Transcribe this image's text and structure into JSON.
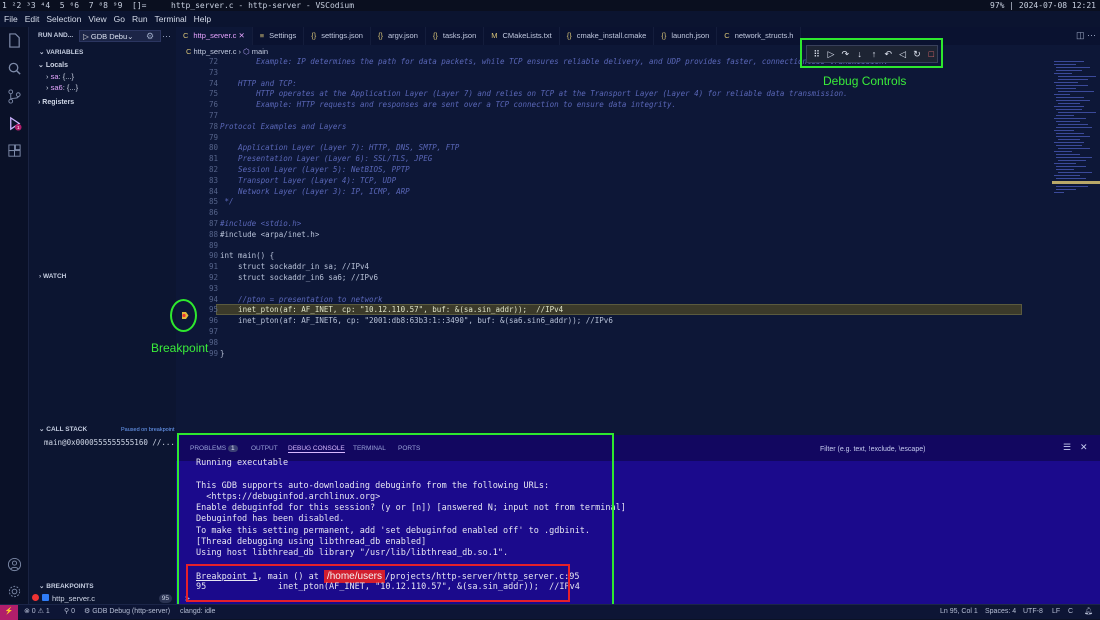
{
  "top_bar": {
    "workspaces": "1 ²2 ³3 ⁴4  5 ⁶6  7 ⁸8 ⁹9  []=",
    "window_title": "http_server.c - http-server - VSCodium",
    "status": "97% | 2024-07-08 12:21"
  },
  "menu": [
    "File",
    "Edit",
    "Selection",
    "View",
    "Go",
    "Run",
    "Terminal",
    "Help"
  ],
  "sidebar": {
    "run_label": "RUN AND...",
    "config": "GDB Debu",
    "variables_header": "VARIABLES",
    "locals": "Locals",
    "vars": [
      {
        "name": "sa",
        "value": "{...}"
      },
      {
        "name": "sa6",
        "value": "{...}"
      }
    ],
    "registers": "Registers",
    "watch_header": "WATCH",
    "call_stack_header": "CALL STACK",
    "call_stack_status": "Paused on breakpoint",
    "call_stack_frame": "main@0x0000555555555160  //...",
    "breakpoints_header": "BREAKPOINTS",
    "breakpoint_file": "http_server.c",
    "breakpoint_line": "95"
  },
  "tabs": [
    {
      "icon": "C",
      "label": "http_server.c",
      "active": true
    },
    {
      "icon": "≡",
      "label": "Settings"
    },
    {
      "icon": "{}",
      "label": "settings.json"
    },
    {
      "icon": "{}",
      "label": "argv.json"
    },
    {
      "icon": "{}",
      "label": "tasks.json"
    },
    {
      "icon": "M",
      "label": "CMakeLists.txt"
    },
    {
      "icon": "{}",
      "label": "cmake_install.cmake"
    },
    {
      "icon": "{}",
      "label": "launch.json"
    },
    {
      "icon": "C",
      "label": "network_structs.h"
    }
  ],
  "breadcrumb": {
    "file": "http_server.c",
    "symbol": "main"
  },
  "code_lines": [
    {
      "n": "72",
      "t": "        Example: IP determines the path for data packets, while TCP ensures reliable delivery, and UDP provides faster, connectionless transmission.",
      "c": "cmt"
    },
    {
      "n": "73",
      "t": "",
      "c": "cmt"
    },
    {
      "n": "74",
      "t": "    HTTP and TCP:",
      "c": "cmt"
    },
    {
      "n": "75",
      "t": "        HTTP operates at the Application Layer (Layer 7) and relies on TCP at the Transport Layer (Layer 4) for reliable data transmission.",
      "c": "cmt"
    },
    {
      "n": "76",
      "t": "        Example: HTTP requests and responses are sent over a TCP connection to ensure data integrity.",
      "c": "cmt"
    },
    {
      "n": "77",
      "t": "",
      "c": "cmt"
    },
    {
      "n": "78",
      "t": "Protocol Examples and Layers",
      "c": "cmt"
    },
    {
      "n": "79",
      "t": "",
      "c": "cmt"
    },
    {
      "n": "80",
      "t": "    Application Layer (Layer 7): HTTP, DNS, SMTP, FTP",
      "c": "cmt"
    },
    {
      "n": "81",
      "t": "    Presentation Layer (Layer 6): SSL/TLS, JPEG",
      "c": "cmt"
    },
    {
      "n": "82",
      "t": "    Session Layer (Layer 5): NetBIOS, PPTP",
      "c": "cmt"
    },
    {
      "n": "83",
      "t": "    Transport Layer (Layer 4): TCP, UDP",
      "c": "cmt"
    },
    {
      "n": "84",
      "t": "    Network Layer (Layer 3): IP, ICMP, ARP",
      "c": "cmt"
    },
    {
      "n": "85",
      "t": " */",
      "c": "cmt"
    },
    {
      "n": "86",
      "t": "",
      "c": ""
    },
    {
      "n": "87",
      "t": "#include <stdio.h>",
      "c": "cmt"
    },
    {
      "n": "88",
      "t": "#include <arpa/inet.h>",
      "c": ""
    },
    {
      "n": "89",
      "t": "",
      "c": ""
    },
    {
      "n": "90",
      "t": "int main() {",
      "c": ""
    },
    {
      "n": "91",
      "t": "    struct sockaddr_in sa; //IPv4",
      "c": ""
    },
    {
      "n": "92",
      "t": "    struct sockaddr_in6 sa6; //IPv6",
      "c": ""
    },
    {
      "n": "93",
      "t": "",
      "c": ""
    },
    {
      "n": "94",
      "t": "    //pton = presentation to network",
      "c": "cmt"
    },
    {
      "n": "95",
      "t": "    inet_pton(af: AF_INET, cp: \"10.12.110.57\", buf: &(sa.sin_addr));  //IPv4",
      "c": "hl"
    },
    {
      "n": "96",
      "t": "    inet_pton(af: AF_INET6, cp: \"2001:db8:63b3:1::3490\", buf: &(sa6.sin6_addr)); //IPv6",
      "c": ""
    },
    {
      "n": "97",
      "t": "",
      "c": ""
    },
    {
      "n": "98",
      "t": "",
      "c": ""
    },
    {
      "n": "99",
      "t": "}",
      "c": ""
    }
  ],
  "annotations": {
    "debug_controls": "Debug Controls",
    "breakpoint": "Breakpoint"
  },
  "debug_toolbar": [
    "⠿",
    "▷",
    "↷",
    "↓",
    "↑",
    "↶",
    "◁",
    "↻",
    "□"
  ],
  "panel": {
    "tabs": [
      "PROBLEMS",
      "OUTPUT",
      "DEBUG CONSOLE",
      "TERMINAL",
      "PORTS"
    ],
    "problems_count": "1",
    "filter_placeholder": "Filter (e.g. text, !exclude, \\escape)",
    "console_lines": [
      "Running executable",
      "",
      "This GDB supports auto-downloading debuginfo from the following URLs:",
      "  <https://debuginfod.archlinux.org>",
      "Enable debuginfod for this session? (y or [n]) [answered N; input not from terminal]",
      "Debuginfod has been disabled.",
      "To make this setting permanent, add 'set debuginfod enabled off' to .gdbinit.",
      "[Thread debugging using libthread_db enabled]",
      "Using host libthread_db library \"/usr/lib/libthread_db.so.1\".",
      ""
    ],
    "bp_hit_prefix": "Breakpoint 1",
    "bp_hit_mid": ", main () at ",
    "bp_hit_redacted": "/home/users",
    "bp_hit_suffix": "/projects/http-server/http_server.c:95",
    "bp_src_line": "95              inet_pton(AF_INET, \"10.12.110.57\", &(sa.sin_addr));  //IPv4",
    "prompt": ">"
  },
  "status_bar": {
    "remote": "⚡",
    "errors": "⊗ 0  ⚠ 1",
    "ports": "⚲ 0",
    "debug": "⚙ GDB Debug (http-server)",
    "clangd": "clangd: idle",
    "position": "Ln 95, Col 1",
    "spaces": "Spaces: 4",
    "encoding": "UTF-8",
    "eol": "LF",
    "lang": "C"
  }
}
